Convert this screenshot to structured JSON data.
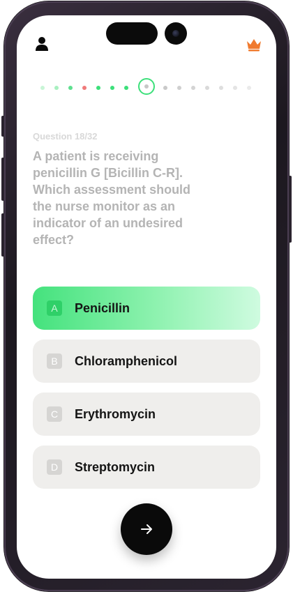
{
  "header": {
    "profile_icon": "user-icon",
    "premium_icon": "crown-icon",
    "premium_color": "#f07a2e"
  },
  "progress": {
    "current_index": 7,
    "dots": [
      {
        "state": "correct-faint",
        "color": "#c8f5d6"
      },
      {
        "state": "correct-faint",
        "color": "#a8f0c0"
      },
      {
        "state": "correct",
        "color": "#5ee08f"
      },
      {
        "state": "wrong",
        "color": "#f07a7a"
      },
      {
        "state": "correct",
        "color": "#3ce07a"
      },
      {
        "state": "correct",
        "color": "#3ce07a"
      },
      {
        "state": "correct",
        "color": "#3ce07a"
      },
      {
        "state": "current",
        "color": "#3ce07a"
      },
      {
        "state": "upcoming",
        "color": "#c9c9c9"
      },
      {
        "state": "upcoming",
        "color": "#cfcfcf"
      },
      {
        "state": "upcoming",
        "color": "#d4d4d4"
      },
      {
        "state": "upcoming",
        "color": "#d9d9d9"
      },
      {
        "state": "upcoming",
        "color": "#dedede"
      },
      {
        "state": "upcoming",
        "color": "#e4e4e4"
      },
      {
        "state": "upcoming",
        "color": "#eaeaea"
      }
    ]
  },
  "question": {
    "number_label": "Question 18/32",
    "text": "A patient is receiving penicillin G [Bicillin C-R]. Which assessment should the nurse monitor as an indicator of an undesired effect?"
  },
  "options": [
    {
      "letter": "A",
      "label": "Penicillin",
      "selected": true
    },
    {
      "letter": "B",
      "label": "Chloramphenicol",
      "selected": false
    },
    {
      "letter": "C",
      "label": "Erythromycin",
      "selected": false
    },
    {
      "letter": "D",
      "label": "Streptomycin",
      "selected": false
    }
  ],
  "next_button": {
    "icon": "arrow-right-icon"
  },
  "colors": {
    "accent_green": "#3ce07a",
    "option_bg": "#efeeec",
    "question_text": "#b4b4b4"
  }
}
